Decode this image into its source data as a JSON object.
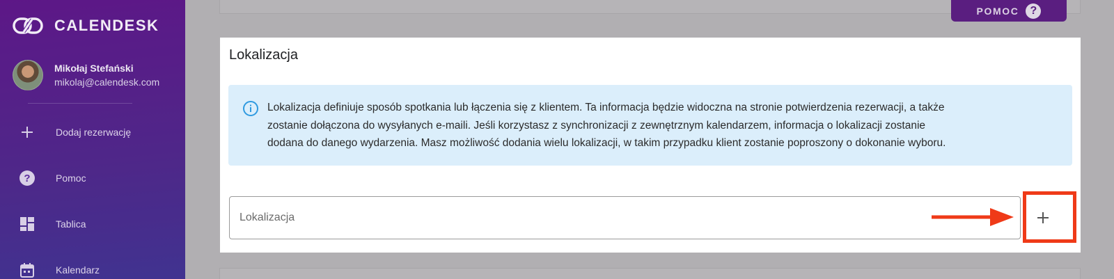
{
  "brand": {
    "name": "CALENDESK"
  },
  "user": {
    "name": "Mikołaj Stefański",
    "email": "mikolaj@calendesk.com"
  },
  "nav": {
    "items": [
      {
        "label": "Dodaj rezerwację",
        "icon": "plus-icon"
      },
      {
        "label": "Pomoc",
        "icon": "help-circle-icon"
      },
      {
        "label": "Tablica",
        "icon": "dashboard-icon"
      },
      {
        "label": "Kalendarz",
        "icon": "calendar-icon"
      }
    ]
  },
  "help_button": {
    "label": "POMOC",
    "icon": "help-circle-icon"
  },
  "card": {
    "title": "Lokalizacja",
    "info_lines": [
      "Lokalizacja definiuje sposób spotkania lub łączenia się z klientem. Ta informacja będzie widoczna na stronie potwierdzenia rezerwacji, a także",
      "zostanie dołączona do wysyłanych e-maili. Jeśli korzystasz z synchronizacji z zewnętrznym kalendarzem, informacja o lokalizacji zostanie",
      "dodana do danego wydarzenia. Masz możliwość dodania wielu lokalizacji, w takim przypadku klient zostanie poproszony o dokonanie wyboru."
    ],
    "location_field": {
      "placeholder": "Lokalizacja",
      "value": ""
    },
    "add_button": {
      "icon": "plus-icon"
    }
  },
  "colors": {
    "sidebar_top": "#6a1b9a",
    "sidebar_bottom": "#4a3aa4",
    "help_button": "#5a1e80",
    "info_background": "#dbeefb",
    "info_icon": "#2f9ae0",
    "annotation": "#ef3a18"
  }
}
